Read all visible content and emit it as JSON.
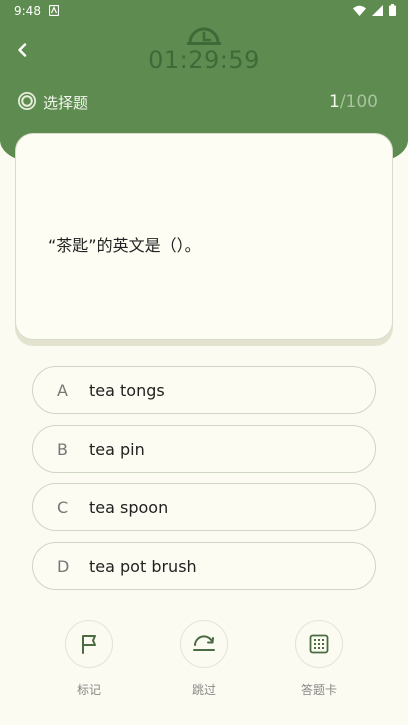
{
  "status_bar": {
    "time": "9:48"
  },
  "timer": {
    "value": "01:29:59"
  },
  "question_type": {
    "label": "选择题"
  },
  "progress": {
    "current": "1",
    "total": "/100"
  },
  "question": {
    "text": "“茶匙”的英文是（）。"
  },
  "options": [
    {
      "letter": "A",
      "text": "tea tongs"
    },
    {
      "letter": "B",
      "text": "tea pin"
    },
    {
      "letter": "C",
      "text": "tea spoon"
    },
    {
      "letter": "D",
      "text": "tea pot brush"
    }
  ],
  "actions": [
    {
      "label": "标记",
      "icon": "flag-icon"
    },
    {
      "label": "跳过",
      "icon": "skip-icon"
    },
    {
      "label": "答题卡",
      "icon": "answer-sheet-icon"
    }
  ],
  "colors": {
    "header": "#5e8b50",
    "timer": "#3f6a38",
    "accent": "#4b6b43",
    "background": "#fbfbf1"
  }
}
